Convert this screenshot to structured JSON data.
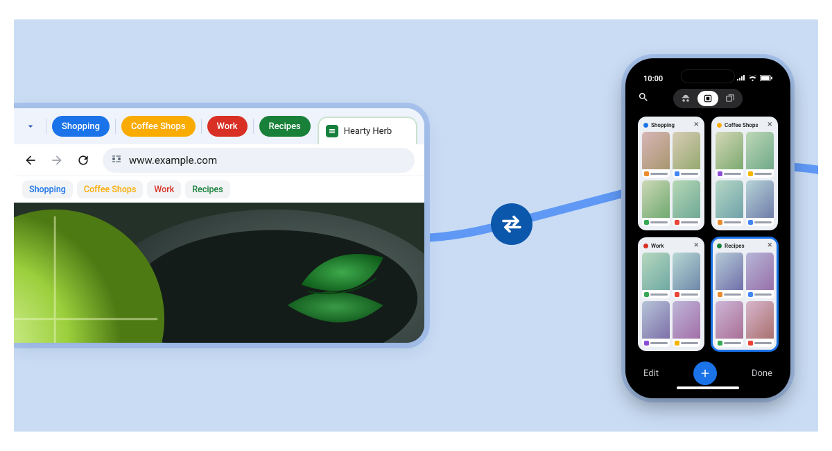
{
  "colors": {
    "blue": "#1a73e8",
    "amber": "#f9ab00",
    "red": "#d93025",
    "green": "#188038"
  },
  "desktop": {
    "tab_groups": [
      {
        "label": "Shopping",
        "color": "#1a73e8"
      },
      {
        "label": "Coffee Shops",
        "color": "#f9ab00"
      },
      {
        "label": "Work",
        "color": "#d93025"
      },
      {
        "label": "Recipes",
        "color": "#188038"
      }
    ],
    "active_tab_title": "Hearty Herb",
    "url": "www.example.com",
    "bookmarks": [
      {
        "label": "Shopping",
        "color": "#1a73e8"
      },
      {
        "label": "Coffee Shops",
        "color": "#f9ab00"
      },
      {
        "label": "Work",
        "color": "#d93025"
      },
      {
        "label": "Recipes",
        "color": "#188038"
      }
    ]
  },
  "phone": {
    "status_time": "10:00",
    "groups": [
      {
        "label": "Shopping",
        "color": "#1a73e8",
        "selected": false
      },
      {
        "label": "Coffee Shops",
        "color": "#f9ab00",
        "selected": false
      },
      {
        "label": "Work",
        "color": "#d93025",
        "selected": false
      },
      {
        "label": "Recipes",
        "color": "#188038",
        "selected": true
      }
    ],
    "bottom": {
      "edit": "Edit",
      "done": "Done"
    }
  }
}
